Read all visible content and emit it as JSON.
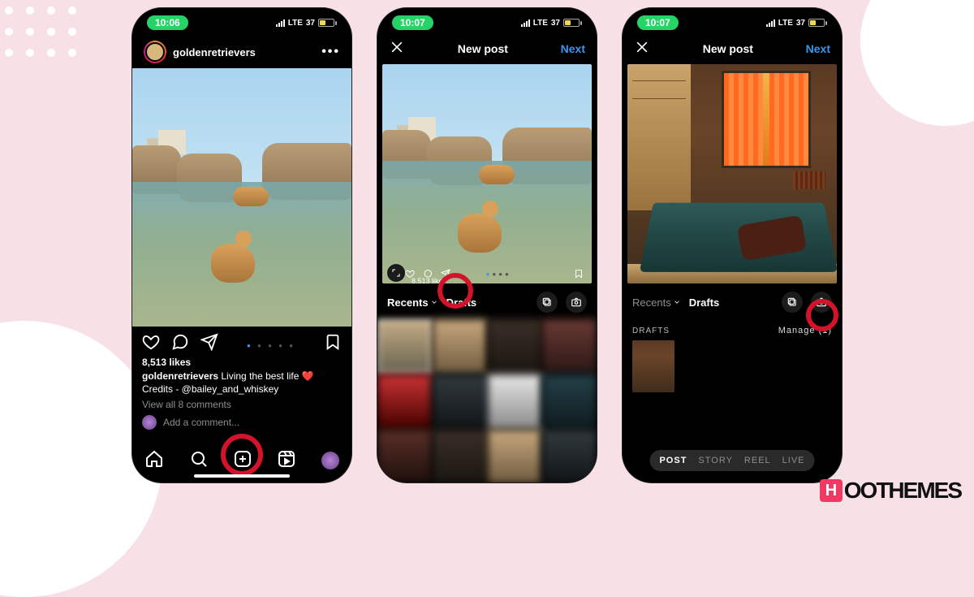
{
  "status": {
    "time1": "10:06",
    "time2": "10:07",
    "time3": "10:07",
    "lte": "LTE",
    "battery": "37"
  },
  "screen1": {
    "username": "goldenretrievers",
    "likes": "8,513 likes",
    "caption_user": "goldenretrievers",
    "caption_text": " Living the best life ",
    "credits": "Credits - @bailey_and_whiskey",
    "view_comments": "View all 8 comments",
    "add_comment": "Add a comment..."
  },
  "screen2": {
    "title": "New post",
    "next": "Next",
    "recents": "Recents",
    "drafts": "Drafts",
    "mini_likes": "8,513 like"
  },
  "screen3": {
    "title": "New post",
    "next": "Next",
    "recents": "Recents",
    "drafts": "Drafts",
    "drafts_header": "DRAFTS",
    "manage": "Manage (1)",
    "modes": {
      "post": "POST",
      "story": "STORY",
      "reel": "REEL",
      "live": "LIVE"
    }
  },
  "brand": {
    "h": "H",
    "rest": "OOTHEMES"
  }
}
